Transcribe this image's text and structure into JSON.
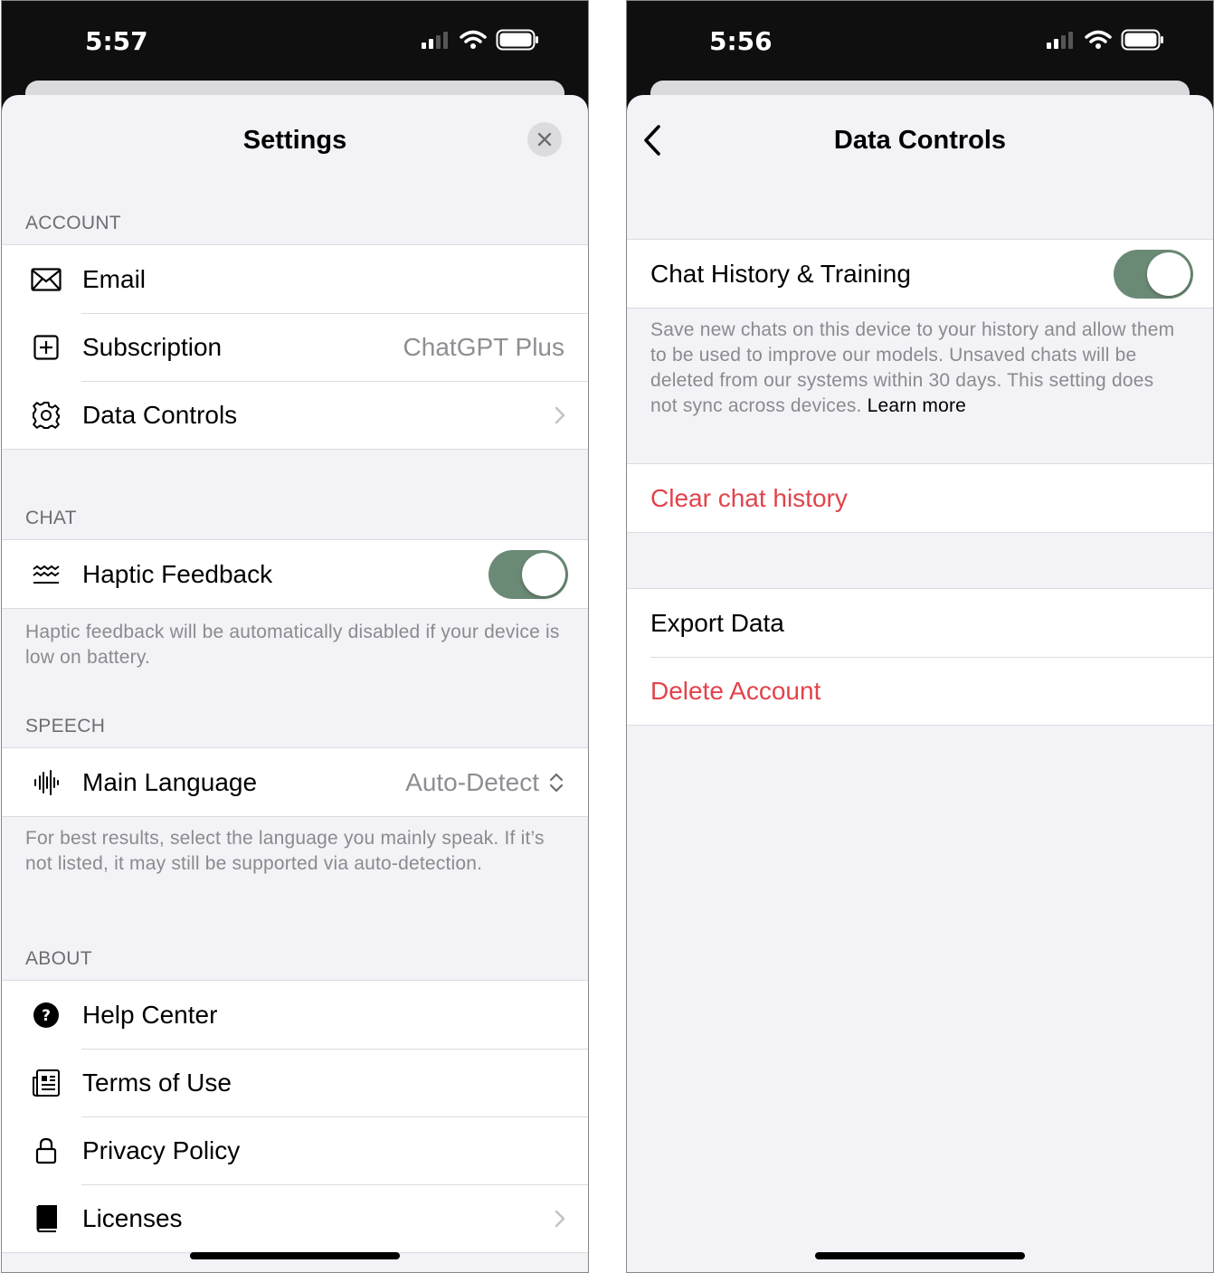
{
  "left": {
    "status": {
      "time": "5:57"
    },
    "title": "Settings",
    "sections": {
      "account": {
        "header": "ACCOUNT",
        "items": [
          {
            "label": "Email",
            "icon": "envelope-icon"
          },
          {
            "label": "Subscription",
            "value": "ChatGPT Plus",
            "icon": "plus-square-icon"
          },
          {
            "label": "Data Controls",
            "icon": "gear-icon"
          }
        ]
      },
      "chat": {
        "header": "CHAT",
        "haptic": {
          "label": "Haptic Feedback",
          "icon": "waves-icon",
          "enabled": true
        },
        "footnote": "Haptic feedback will be automatically disabled if your device is low on battery."
      },
      "speech": {
        "header": "SPEECH",
        "language": {
          "label": "Main Language",
          "value": "Auto-Detect",
          "icon": "waveform-icon"
        },
        "footnote": "For best results, select the language you mainly speak. If it’s not listed, it may still be supported via auto-detection."
      },
      "about": {
        "header": "ABOUT",
        "items": [
          {
            "label": "Help Center",
            "icon": "question-circle-icon"
          },
          {
            "label": "Terms of Use",
            "icon": "document-icon"
          },
          {
            "label": "Privacy Policy",
            "icon": "lock-icon"
          },
          {
            "label": "Licenses",
            "icon": "book-icon"
          }
        ]
      }
    }
  },
  "right": {
    "status": {
      "time": "5:56"
    },
    "title": "Data Controls",
    "chat_history": {
      "label": "Chat History & Training",
      "enabled": true,
      "footnote": "Save new chats on this device to your history and allow them to be used to improve our models. Unsaved chats will be deleted from our systems within 30 days. This setting does not sync across devices.",
      "learn_more": "Learn more"
    },
    "clear_history": "Clear chat history",
    "export_data": "Export Data",
    "delete_account": "Delete Account"
  },
  "colors": {
    "toggle_on": "#6b8a75",
    "destructive": "#e2434b",
    "background": "#f2f2f7"
  }
}
